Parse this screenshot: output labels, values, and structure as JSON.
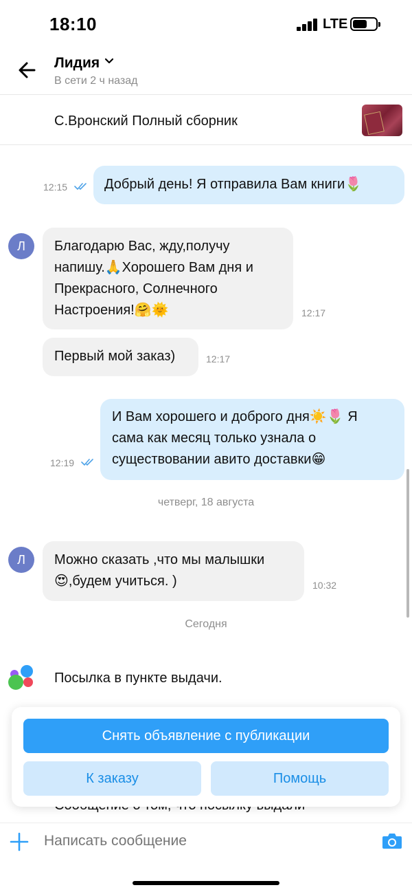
{
  "status_bar": {
    "time": "18:10",
    "network": "LTE"
  },
  "header": {
    "name": "Лидия",
    "status": "В сети 2 ч назад"
  },
  "listing": {
    "title": "С.Вронский Полный сборник"
  },
  "messages": [
    {
      "dir": "out",
      "text": "Добрый день! Я отправила Вам книги🌷",
      "time": "12:15"
    },
    {
      "dir": "in",
      "avatar": "Л",
      "lines": [
        "Благодарю Вас, жду,получу",
        "напишу.🙏Хорошего Вам дня и",
        "Прекрасного, Солнечного",
        "Настроения!🤗🌞"
      ],
      "time": "12:17"
    },
    {
      "dir": "in",
      "text": "Первый мой заказ)",
      "time": "12:17"
    },
    {
      "dir": "out",
      "lines": [
        "И Вам хорошего и доброго дня☀️🌷 Я",
        "сама как месяц только узнала о",
        "существовании авито доставки😁"
      ],
      "time": "12:19"
    },
    {
      "dir": "in",
      "avatar": "Л",
      "lines": [
        "Можно сказать ,что мы малышки",
        "😍,будем учиться. )"
      ],
      "time": "10:32"
    }
  ],
  "date_separators": [
    "четверг, 18 августа",
    "Сегодня"
  ],
  "system_message": {
    "text": "Посылка в пункте выдачи.",
    "subtext": "Сообщение о том, что посылку выдали"
  },
  "actions": {
    "primary": "Снять объявление с публикации",
    "order": "К заказу",
    "help": "Помощь"
  },
  "composer": {
    "placeholder": "Написать сообщение"
  },
  "colors": {
    "accent": "#2f9ff8",
    "outgoing_bubble": "#d9eefd",
    "incoming_bubble": "#f1f1f1",
    "avatar": "#6b7dc8"
  }
}
